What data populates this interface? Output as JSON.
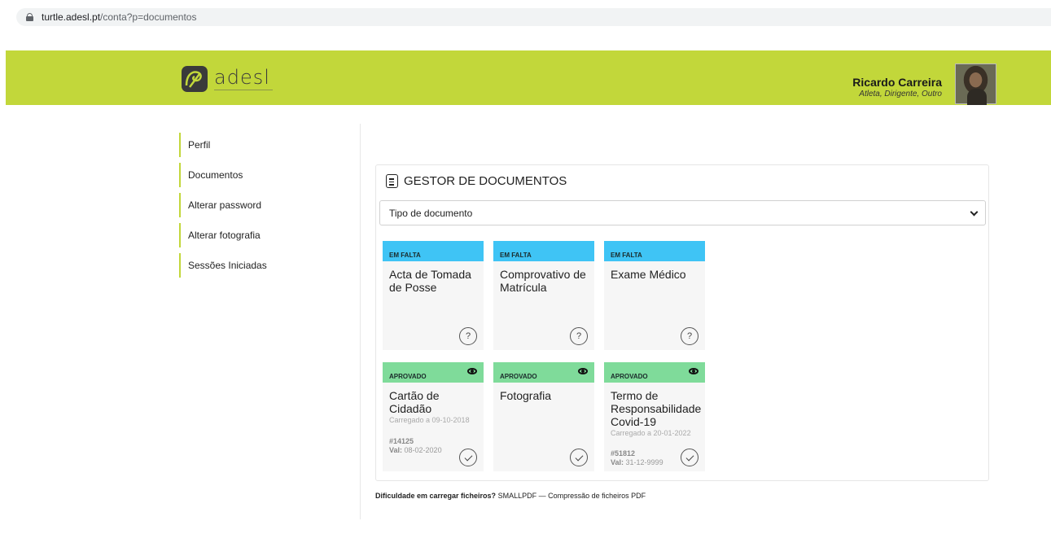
{
  "browser": {
    "domain": "turtle.adesl.pt",
    "path": "/conta?p=documentos"
  },
  "brand": {
    "name": "adesl"
  },
  "user": {
    "name": "Ricardo Carreira",
    "roles": "Atleta, Dirigente, Outro"
  },
  "sidebar": {
    "items": [
      {
        "label": "Perfil"
      },
      {
        "label": "Documentos"
      },
      {
        "label": "Alterar password"
      },
      {
        "label": "Alterar fotografia"
      },
      {
        "label": "Sessões Iniciadas"
      }
    ]
  },
  "manager": {
    "title": "GESTOR DE DOCUMENTOS",
    "select_value": "Tipo de documento",
    "cards": [
      {
        "status": "EM FALTA",
        "title": "Acta de Tomada de Posse",
        "action": "?"
      },
      {
        "status": "EM FALTA",
        "title": "Comprovativo de Matrícula",
        "action": "?"
      },
      {
        "status": "EM FALTA",
        "title": "Exame Médico",
        "action": "?"
      },
      {
        "status": "APROVADO",
        "title": "Cartão de Cidadão",
        "uploaded": "Carregado a 09-10-2018",
        "ref": "#14125",
        "val_label": "Val:",
        "val": "08-02-2020"
      },
      {
        "status": "APROVADO",
        "title": "Fotografia"
      },
      {
        "status": "APROVADO",
        "title": "Termo de Responsabilidade Covid-19",
        "uploaded": "Carregado a 20-01-2022",
        "ref": "#51812",
        "val_label": "Val:",
        "val": "31-12-9999"
      }
    ]
  },
  "footer": {
    "question": "Dificuldade em carregar ficheiros?",
    "link": "SMALLPDF",
    "dash": "—",
    "rest": "Compressão de ficheiros PDF"
  },
  "colors": {
    "header": "#c2d73a",
    "missing": "#3fc4f5",
    "approved": "#7fdb9a"
  }
}
